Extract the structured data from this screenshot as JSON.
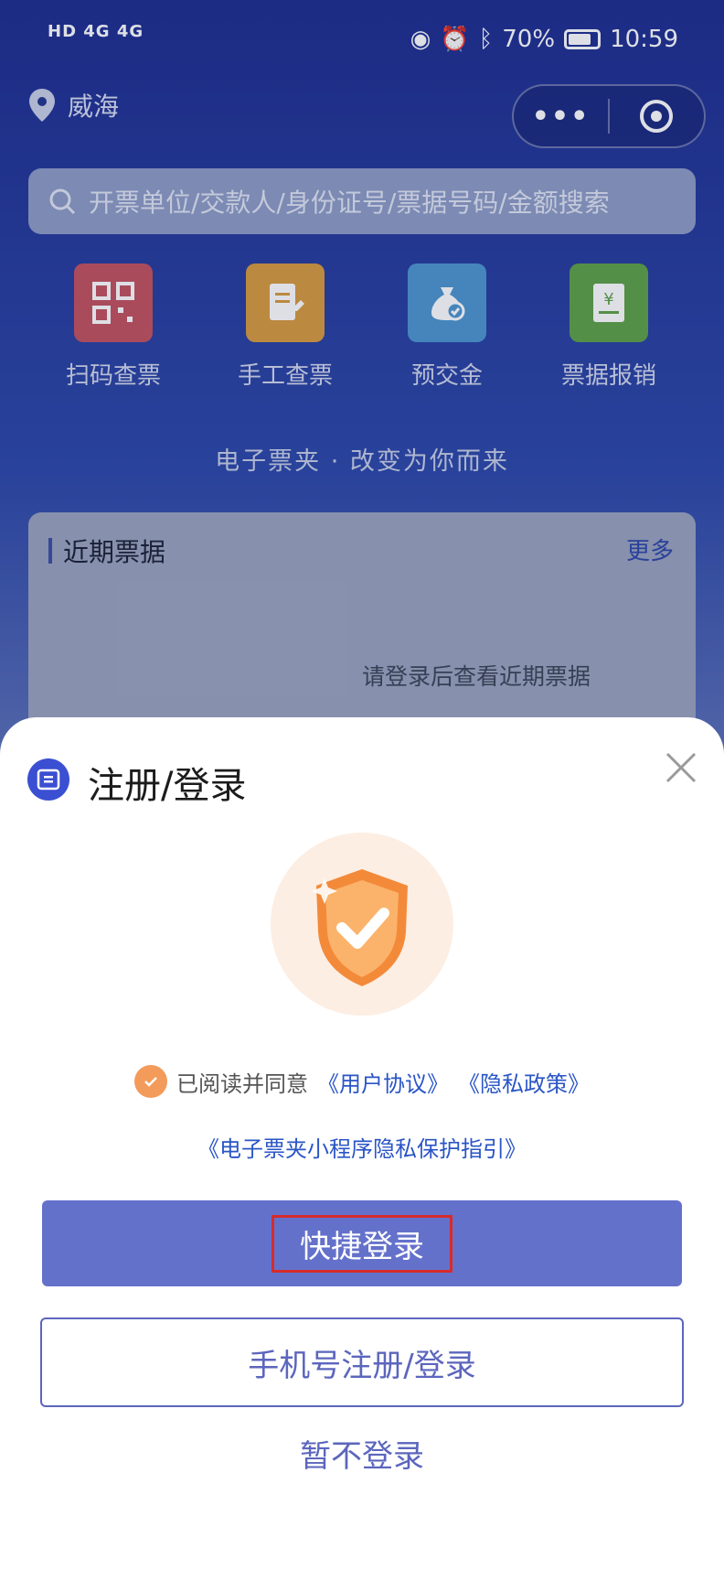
{
  "status": {
    "signal": "HD 4G 4G",
    "battery": "70%",
    "time": "10:59"
  },
  "location": "威海",
  "capsule": {
    "more": "•••"
  },
  "search": {
    "placeholder": "开票单位/交款人/身份证号/票据号码/金额搜索"
  },
  "quick_actions": [
    {
      "label": "扫码查票",
      "icon": "qr-code-icon",
      "color": "#d9434c"
    },
    {
      "label": "手工查票",
      "icon": "edit-document-icon",
      "color": "#e99a2c"
    },
    {
      "label": "预交金",
      "icon": "money-bag-icon",
      "color": "#3b9ad9"
    },
    {
      "label": "票据报销",
      "icon": "receipt-icon",
      "color": "#4ea53a"
    }
  ],
  "slogan": "电子票夹 · 改变为你而来",
  "recent": {
    "title": "近期票据",
    "more": "更多",
    "empty": "请登录后查看近期票据"
  },
  "sheet": {
    "title": "注册/登录",
    "agree_prefix": "已阅读并同意",
    "user_agreement": "《用户协议》",
    "privacy_policy": "《隐私政策》",
    "guide": "《电子票夹小程序隐私保护指引》",
    "quick_login": "快捷登录",
    "phone_login": "手机号注册/登录",
    "skip": "暂不登录"
  },
  "colors": {
    "accent": "#6471cb",
    "link": "#2a55c6",
    "check": "#f39b5a"
  }
}
